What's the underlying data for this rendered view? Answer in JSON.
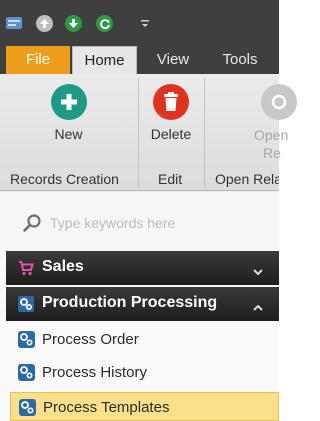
{
  "quick_access": {
    "icons": [
      "app-icon",
      "up-arrow-icon",
      "down-arrow-icon",
      "refresh-icon",
      "customize-icon"
    ]
  },
  "tabs": [
    {
      "label": "File",
      "active": false
    },
    {
      "label": "Home",
      "active": true
    },
    {
      "label": "View",
      "active": false
    },
    {
      "label": "Tools",
      "active": false
    }
  ],
  "ribbon": {
    "new_label": "New",
    "delete_label": "Delete",
    "open_label_line1": "Open",
    "open_label_line2": "Re",
    "groups": [
      "Records Creation",
      "Edit",
      "Open Rela"
    ]
  },
  "search": {
    "placeholder": "Type keywords here"
  },
  "sections": {
    "sales": {
      "title": "Sales",
      "expanded": false
    },
    "production": {
      "title": "Production Processing",
      "expanded": true
    }
  },
  "items": [
    {
      "label": "Process Order",
      "selected": false
    },
    {
      "label": "Process History",
      "selected": false
    },
    {
      "label": "Process Templates",
      "selected": true
    }
  ],
  "colors": {
    "file_tab": "#ef9d1c",
    "new_button": "#1d9b86",
    "delete_button": "#e0321f",
    "selected_item": "#fbe08c",
    "section_header": "#2b2b2b"
  }
}
